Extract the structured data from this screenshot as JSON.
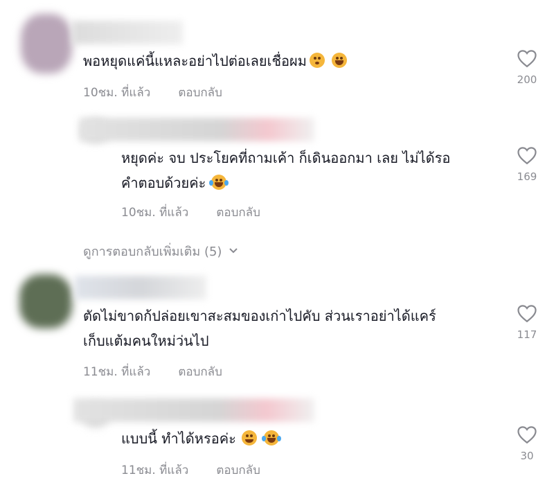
{
  "comments": [
    {
      "text_lines": [
        "พอหยุดแค่นี้แหละอย่าไปต่อเลยเชื่อผม"
      ],
      "emojis": [
        "flushed-face",
        "grinning-face"
      ],
      "time": "10ชม. ที่แล้ว",
      "reply_label": "ตอบกลับ",
      "likes": "200"
    },
    {
      "text_lines": [
        "หยุดค่ะ จบ ประโยคที่ถามเค้า ก็เดินออกมา เลย ไม่ได้รอ",
        "คำตอบด้วยค่ะ"
      ],
      "emojis": [
        "tears-of-joy-face"
      ],
      "time": "10ชม. ที่แล้ว",
      "reply_label": "ตอบกลับ",
      "likes": "169"
    },
    {
      "text_lines": [
        "ตัดไม่ขาดก้ปล่อยเขาสะสมของเก่าไปคับ ส่วนเราอย่าได้แคร์",
        "เก็บแต้มคนใหม่ว่นไป"
      ],
      "emojis": [],
      "time": "11ชม. ที่แล้ว",
      "reply_label": "ตอบกลับ",
      "likes": "117"
    },
    {
      "text_lines": [
        "แบบนี้ ทำได้หรอค่ะ"
      ],
      "emojis": [
        "smiling-face",
        "tears-of-joy-face"
      ],
      "time": "11ชม. ที่แล้ว",
      "reply_label": "ตอบกลับ",
      "likes": "30"
    }
  ],
  "view_more": "ดูการตอบกลับเพิ่มเติม (5)",
  "colors": {
    "text": "#161823",
    "muted": "#8a8b91",
    "emoji": "#f5b63b"
  }
}
